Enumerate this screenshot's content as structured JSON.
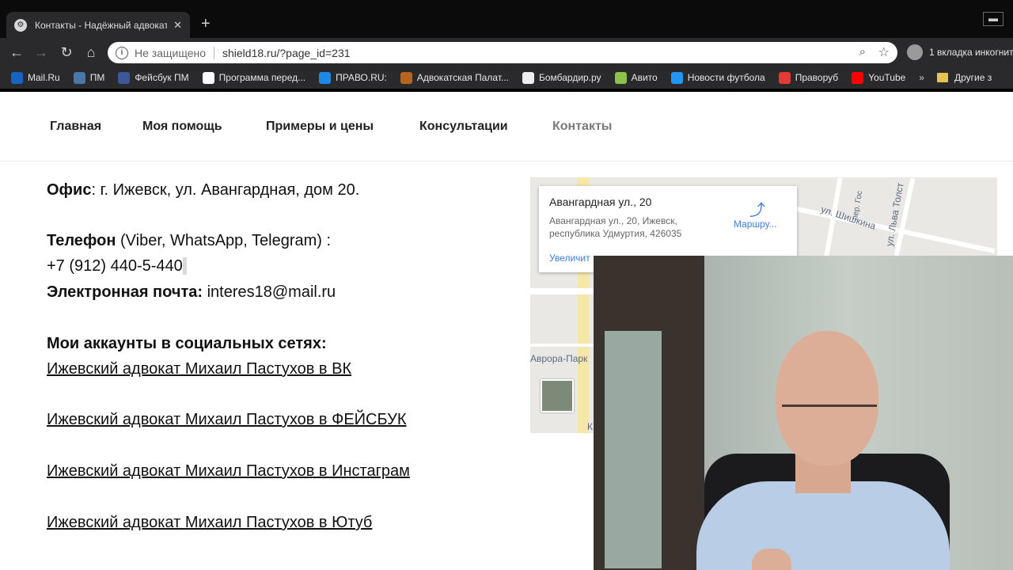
{
  "browser": {
    "tab_title": "Контакты - Надёжный адвокат",
    "tab_close": "✕",
    "new_tab": "+",
    "window_control": "▬",
    "not_secure": "Не защищено",
    "url": "shield18.ru/?page_id=231",
    "incognito_label": "1 вкладка инкогнит",
    "bookmarks": [
      {
        "label": "Mail.Ru",
        "color": "#1565c0"
      },
      {
        "label": "ПМ",
        "color": "#4a76a8"
      },
      {
        "label": "Фейсбук ПМ",
        "color": "#3b5998"
      },
      {
        "label": "Программа перед...",
        "color": "#ffffff"
      },
      {
        "label": "ПРАВО.RU:",
        "color": "#1e88e5"
      },
      {
        "label": "Адвокатская Палат...",
        "color": "#b5651d"
      },
      {
        "label": "Бомбардир.ру",
        "color": "#eeeeee"
      },
      {
        "label": "Авито",
        "color": "#8bc34a"
      },
      {
        "label": "Новости футбола",
        "color": "#2196f3"
      },
      {
        "label": "Праворуб",
        "color": "#e53935"
      },
      {
        "label": "YouTube",
        "color": "#ff0000"
      }
    ],
    "bookmarks_more": "»",
    "other_bookmarks": "Другие з"
  },
  "site_nav": [
    {
      "label": "Главная",
      "active": false
    },
    {
      "label": "Моя помощь",
      "active": false
    },
    {
      "label": "Примеры и цены",
      "active": false
    },
    {
      "label": "Консультации",
      "active": false
    },
    {
      "label": "Контакты",
      "active": true
    }
  ],
  "content": {
    "office_label": "Офис",
    "office_value": ": г. Ижевск, ул. Авангардная, дом 20.",
    "phone_label": "Телефон",
    "phone_note": " (Viber, WhatsApp, Telegram) :",
    "phone_number": "+7 (912) 440-5-440",
    "email_label": "Электронная почта:",
    "email_value": " interes18@mail.ru",
    "social_heading": "Мои аккаунты в социальных сетях:",
    "social_links": [
      "Ижевский адвокат Михаил Пастухов в ВК",
      "Ижевский адвокат Михаил Пастухов в ФЕЙСБУК",
      "Ижевский адвокат Михаил Пастухов в Инстаграм",
      "Ижевский адвокат Михаил Пастухов в Ютуб"
    ]
  },
  "map": {
    "place_title": "Авангардная ул., 20",
    "place_address": "Авангардная ул., 20, Ижевск, республика Удмуртия, 426035",
    "route_label": "Маршру...",
    "enlarge_label": "Увеличит",
    "street_1": "ул. Шишкина",
    "street_2": "ул. Льва Толст",
    "street_3": "пер. Гос",
    "area_label": "Аврора-Парк",
    "edge_letter": "К"
  }
}
